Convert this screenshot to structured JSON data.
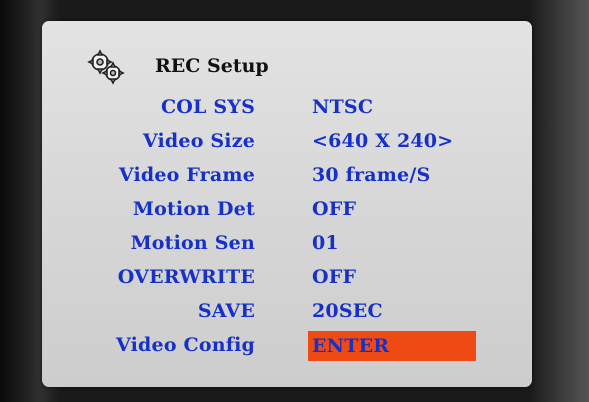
{
  "menu": {
    "title": "REC Setup",
    "icon": "gears-icon",
    "accent_color": "#1630c8",
    "highlight_color": "#f04a14",
    "items": [
      {
        "label": "COL SYS",
        "value": "NTSC"
      },
      {
        "label": "Video Size",
        "value": "<640 X 240>"
      },
      {
        "label": "Video Frame",
        "value": "30 frame/S"
      },
      {
        "label": "Motion Det",
        "value": "OFF"
      },
      {
        "label": "Motion Sen",
        "value": "01"
      },
      {
        "label": "OVERWRITE",
        "value": "OFF"
      },
      {
        "label": "SAVE",
        "value": "20SEC"
      },
      {
        "label": "Video Config",
        "value": "ENTER",
        "selected": true
      }
    ]
  }
}
